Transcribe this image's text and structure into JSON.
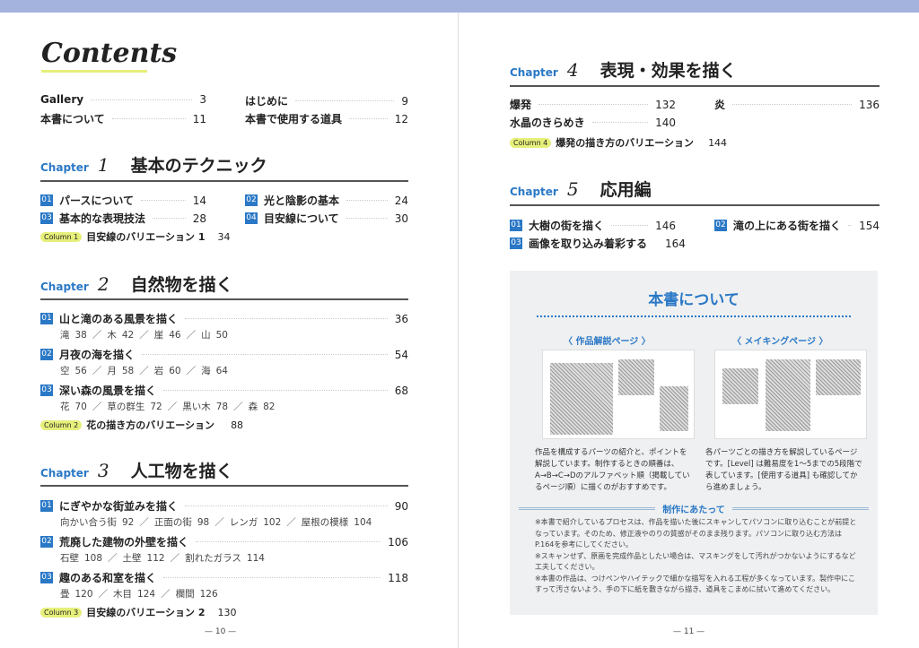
{
  "left": {
    "title": "Contents",
    "front": [
      {
        "label": "Gallery",
        "page": "3"
      },
      {
        "label": "はじめに",
        "page": "9"
      },
      {
        "label": "本書について",
        "page": "11"
      },
      {
        "label": "本書で使用する道具",
        "page": "12"
      }
    ],
    "chapters": [
      {
        "chapter": "Chapter",
        "num": "1",
        "title": "基本のテクニック",
        "items": [
          {
            "no": "01",
            "label": "パースについて",
            "page": "14"
          },
          {
            "no": "02",
            "label": "光と陰影の基本",
            "page": "24"
          },
          {
            "no": "03",
            "label": "基本的な表現技法",
            "page": "28"
          },
          {
            "no": "04",
            "label": "目安線について",
            "page": "30"
          }
        ],
        "column": {
          "tag": "Column 1",
          "label": "目安線のバリエーション 1",
          "page": "34"
        }
      },
      {
        "chapter": "Chapter",
        "num": "2",
        "title": "自然物を描く",
        "items": [
          {
            "no": "01",
            "label": "山と滝のある風景を描く",
            "page": "36",
            "subs": [
              [
                "滝",
                "38"
              ],
              [
                "木",
                "42"
              ],
              [
                "崖",
                "46"
              ],
              [
                "山",
                "50"
              ]
            ]
          },
          {
            "no": "02",
            "label": "月夜の海を描く",
            "page": "54",
            "subs": [
              [
                "空",
                "56"
              ],
              [
                "月",
                "58"
              ],
              [
                "岩",
                "60"
              ],
              [
                "海",
                "64"
              ]
            ]
          },
          {
            "no": "03",
            "label": "深い森の風景を描く",
            "page": "68",
            "subs": [
              [
                "花",
                "70"
              ],
              [
                "草の群生",
                "72"
              ],
              [
                "黒い木",
                "78"
              ],
              [
                "森",
                "82"
              ]
            ]
          }
        ],
        "column": {
          "tag": "Column 2",
          "label": "花の描き方のバリエーション",
          "page": "88"
        }
      },
      {
        "chapter": "Chapter",
        "num": "3",
        "title": "人工物を描く",
        "items": [
          {
            "no": "01",
            "label": "にぎやかな街並みを描く",
            "page": "90",
            "subs": [
              [
                "向かい合う街",
                "92"
              ],
              [
                "正面の街",
                "98"
              ],
              [
                "レンガ",
                "102"
              ],
              [
                "屋根の模様",
                "104"
              ]
            ]
          },
          {
            "no": "02",
            "label": "荒廃した建物の外壁を描く",
            "page": "106",
            "subs": [
              [
                "石壁",
                "108"
              ],
              [
                "土壁",
                "112"
              ],
              [
                "割れたガラス",
                "114"
              ]
            ]
          },
          {
            "no": "03",
            "label": "趣のある和室を描く",
            "page": "118",
            "subs": [
              [
                "畳",
                "120"
              ],
              [
                "木目",
                "124"
              ],
              [
                "欄間",
                "126"
              ]
            ]
          }
        ],
        "column": {
          "tag": "Column 3",
          "label": "目安線のバリエーション 2",
          "page": "130"
        }
      }
    ],
    "page_number": "— 10 —"
  },
  "right": {
    "chapters": [
      {
        "chapter": "Chapter",
        "num": "4",
        "title": "表現・効果を描く",
        "items": [
          {
            "label": "爆発",
            "page": "132"
          },
          {
            "label": "炎",
            "page": "136"
          },
          {
            "label": "水晶のきらめき",
            "page": "140"
          }
        ],
        "column": {
          "tag": "Column 4",
          "label": "爆発の描き方のバリエーション",
          "page": "144"
        }
      },
      {
        "chapter": "Chapter",
        "num": "5",
        "title": "応用編",
        "items": [
          {
            "no": "01",
            "label": "大樹の街を描く",
            "page": "146"
          },
          {
            "no": "02",
            "label": "滝の上にある街を描く",
            "page": "154"
          },
          {
            "no": "03",
            "label": "画像を取り込み着彩する",
            "page": "164"
          }
        ]
      }
    ],
    "about": {
      "title": "本書について",
      "left_caption": "〈 作品解説ページ 〉",
      "right_caption": "〈 メイキングページ 〉",
      "left_desc": "作品を構成するパーツの紹介と、ポイントを解説しています。制作するときの順番は、A→B→C→Dのアルファベット順（掲載しているページ順）に描くのがおすすめです。",
      "right_desc": "各パーツごとの描き方を解説しているページです。[Level] は難易度を1〜5までの5段階で表しています。[使用する道具] も確認してから進めましょう。",
      "notes_title": "制作にあたって",
      "notes": [
        "※本書で紹介しているプロセスは、作品を描いた後にスキャンしてパソコンに取り込むことが前提となっています。そのため、修正液やのりの質感がそのまま残ります。パソコンに取り込む方法はP.164を参考にしてください。",
        "※スキャンせず、原画を完成作品としたい場合は、マスキングをして汚れがつかないようにするなど工夫してください。",
        "※本書の作品は、つけペンやハイテックで細かな描写を入れる工程が多くなっています。製作中にこすって汚さないよう、手の下に紙を敷きながら描き、道具をこまめに拭いて進めてください。"
      ]
    },
    "page_number": "— 11 —"
  },
  "colors": {
    "accent": "#2a78c6",
    "highlight": "#e6ef7a",
    "topbar": "#a3b3de"
  }
}
